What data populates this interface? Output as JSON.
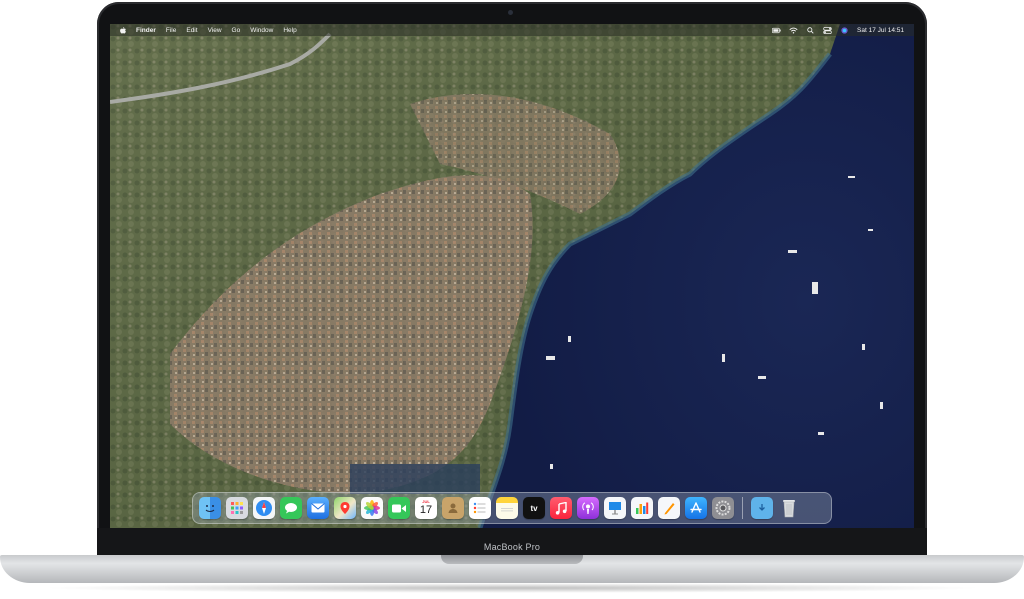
{
  "device": {
    "label": "MacBook Pro"
  },
  "menubar": {
    "app_name": "Finder",
    "items": [
      "File",
      "Edit",
      "View",
      "Go",
      "Window",
      "Help"
    ],
    "clock": "Sat 17 Jul  14:51"
  },
  "dock": {
    "apps": [
      {
        "name": "Finder",
        "icon": "finder-icon"
      },
      {
        "name": "Launchpad",
        "icon": "launchpad-icon"
      },
      {
        "name": "Safari",
        "icon": "safari-icon"
      },
      {
        "name": "Messages",
        "icon": "messages-icon"
      },
      {
        "name": "Mail",
        "icon": "mail-icon"
      },
      {
        "name": "Maps",
        "icon": "maps-icon"
      },
      {
        "name": "Photos",
        "icon": "photos-icon"
      },
      {
        "name": "FaceTime",
        "icon": "facetime-icon"
      },
      {
        "name": "Calendar",
        "icon": "calendar-icon"
      },
      {
        "name": "Contacts",
        "icon": "contacts-icon"
      },
      {
        "name": "Reminders",
        "icon": "reminders-icon"
      },
      {
        "name": "Notes",
        "icon": "notes-icon"
      },
      {
        "name": "TV",
        "icon": "tv-icon"
      },
      {
        "name": "Music",
        "icon": "music-icon"
      },
      {
        "name": "Podcasts",
        "icon": "podcasts-icon"
      },
      {
        "name": "Keynote",
        "icon": "keynote-icon"
      },
      {
        "name": "Numbers",
        "icon": "numbers-icon"
      },
      {
        "name": "Pages",
        "icon": "pages-icon"
      },
      {
        "name": "App Store",
        "icon": "app-store-icon"
      },
      {
        "name": "System Preferences",
        "icon": "system-preferences-icon"
      }
    ],
    "calendar": {
      "month": "JUL",
      "day": "17"
    },
    "tv_label": "tv",
    "stacks": [
      {
        "name": "Downloads",
        "icon": "downloads-folder-icon"
      },
      {
        "name": "Trash",
        "icon": "trash-icon"
      }
    ]
  },
  "colors": {
    "sea": "#16224f",
    "land": "#5e6a4a",
    "menubar": "#282c24",
    "dock": "#aab4c3"
  }
}
